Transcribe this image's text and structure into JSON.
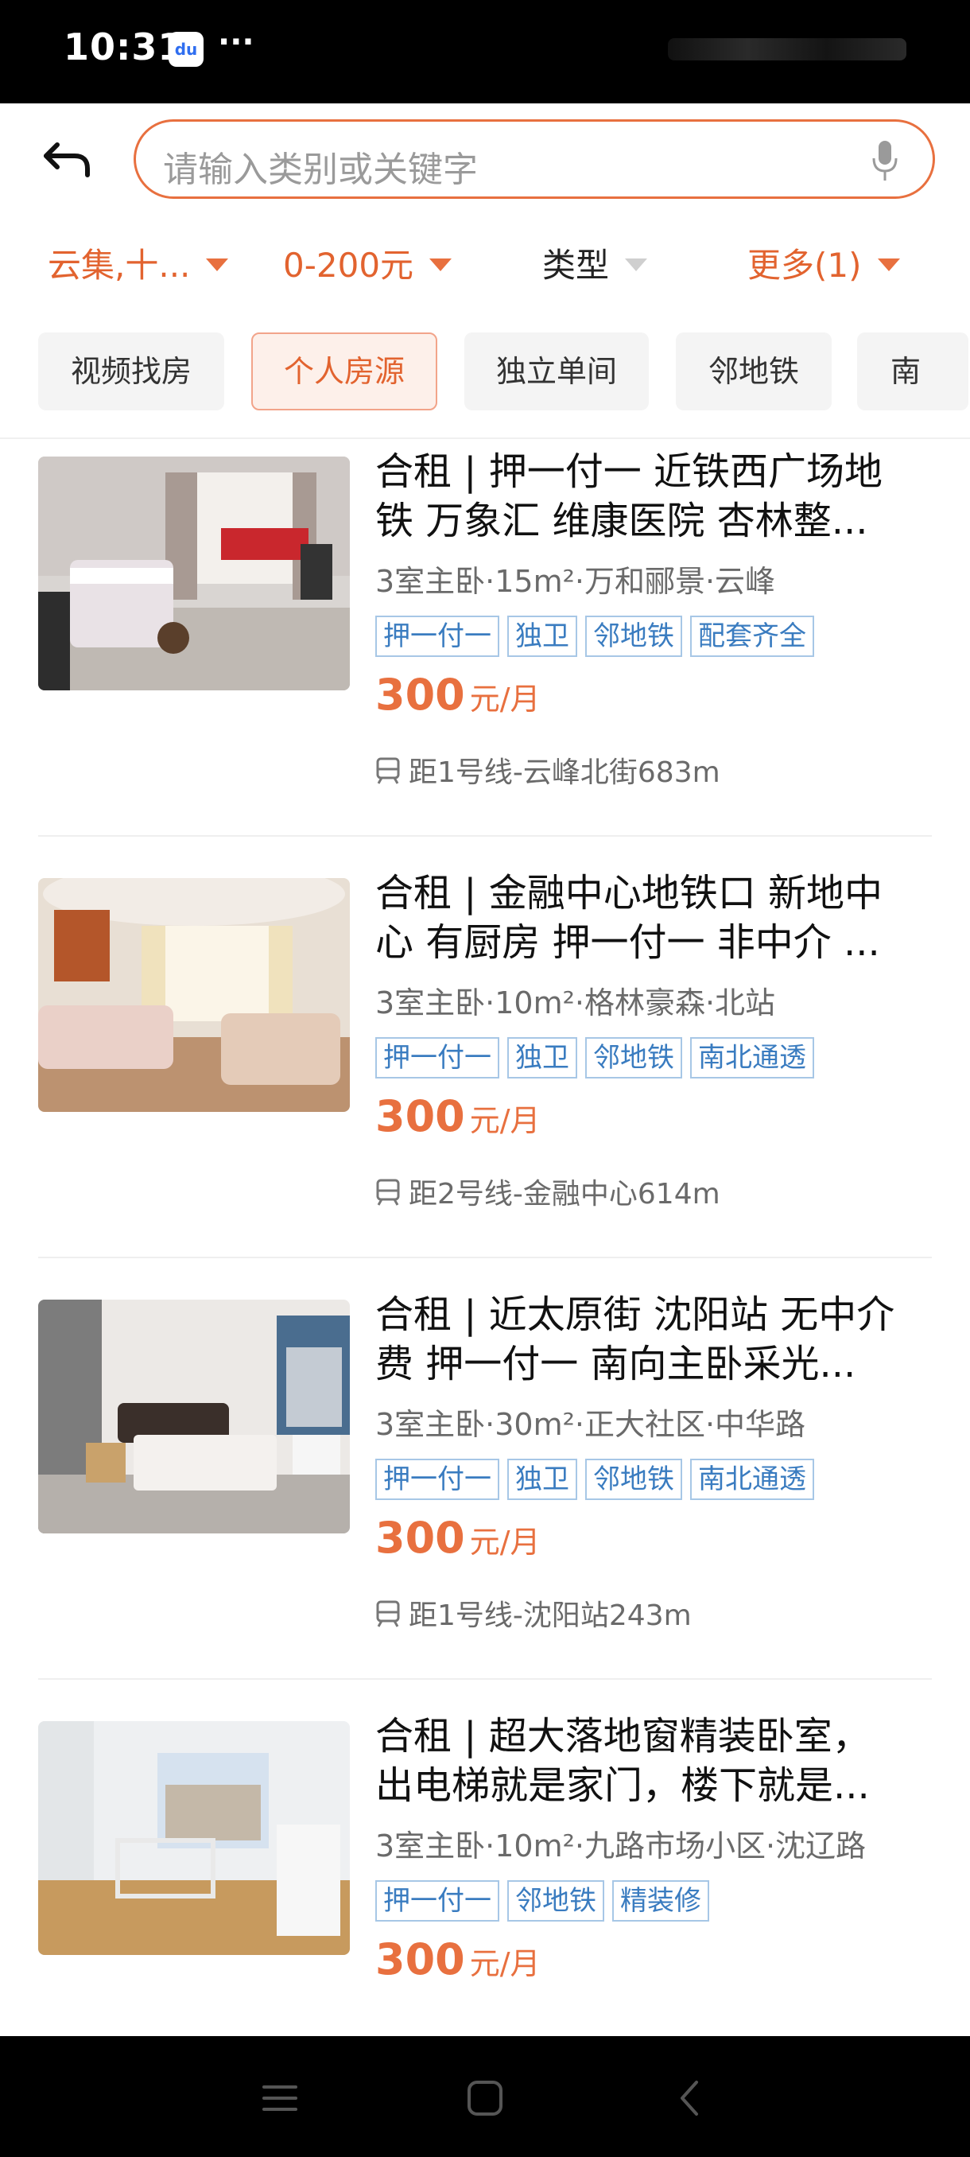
{
  "status_bar": {
    "time": "10:31",
    "app_icon_text": "du",
    "more_dots": "···"
  },
  "search": {
    "placeholder": "请输入类别或关键字"
  },
  "filters": [
    {
      "label": "云集,十...",
      "active": true
    },
    {
      "label": "0-200元",
      "active": true
    },
    {
      "label": "类型",
      "active": false
    },
    {
      "label": "更多(1)",
      "active": true
    }
  ],
  "chips": [
    {
      "label": "视频找房",
      "selected": false
    },
    {
      "label": "个人房源",
      "selected": true
    },
    {
      "label": "独立单间",
      "selected": false
    },
    {
      "label": "邻地铁",
      "selected": false
    },
    {
      "label": "南",
      "selected": false
    }
  ],
  "listings": [
    {
      "title_line1": "合租 | 押一付一 近铁西广场地",
      "title_line2": "铁 万象汇 维康医院 杏林整...",
      "meta": "3室主卧·15m²·万和郦景·云峰",
      "tags": [
        "押一付一",
        "独卫",
        "邻地铁",
        "配套齐全"
      ],
      "price": "300",
      "price_unit": "元/月",
      "subway": "距1号线-云峰北街683m"
    },
    {
      "title_line1": "合租 | 金融中心地铁口  新地中",
      "title_line2": "心 有厨房 押一付一 非中介 ...",
      "meta": "3室主卧·10m²·格林豪森·北站",
      "tags": [
        "押一付一",
        "独卫",
        "邻地铁",
        "南北通透"
      ],
      "price": "300",
      "price_unit": "元/月",
      "subway": "距2号线-金融中心614m"
    },
    {
      "title_line1": "合租 | 近太原街 沈阳站 无中介",
      "title_line2": "费 押一付一 南向主卧采光...",
      "meta": "3室主卧·30m²·正大社区·中华路",
      "tags": [
        "押一付一",
        "独卫",
        "邻地铁",
        "南北通透"
      ],
      "price": "300",
      "price_unit": "元/月",
      "subway": "距1号线-沈阳站243m"
    },
    {
      "title_line1": "合租 | 超大落地窗精装卧室，",
      "title_line2": "出电梯就是家门，楼下就是...",
      "meta": "3室主卧·10m²·九路市场小区·沈辽路",
      "tags": [
        "押一付一",
        "邻地铁",
        "精装修"
      ],
      "price": "300",
      "price_unit": "元/月",
      "subway": ""
    }
  ],
  "colors": {
    "accent": "#e8703f",
    "tag_border": "#a7c7e6",
    "tag_text": "#3a7cc0"
  }
}
